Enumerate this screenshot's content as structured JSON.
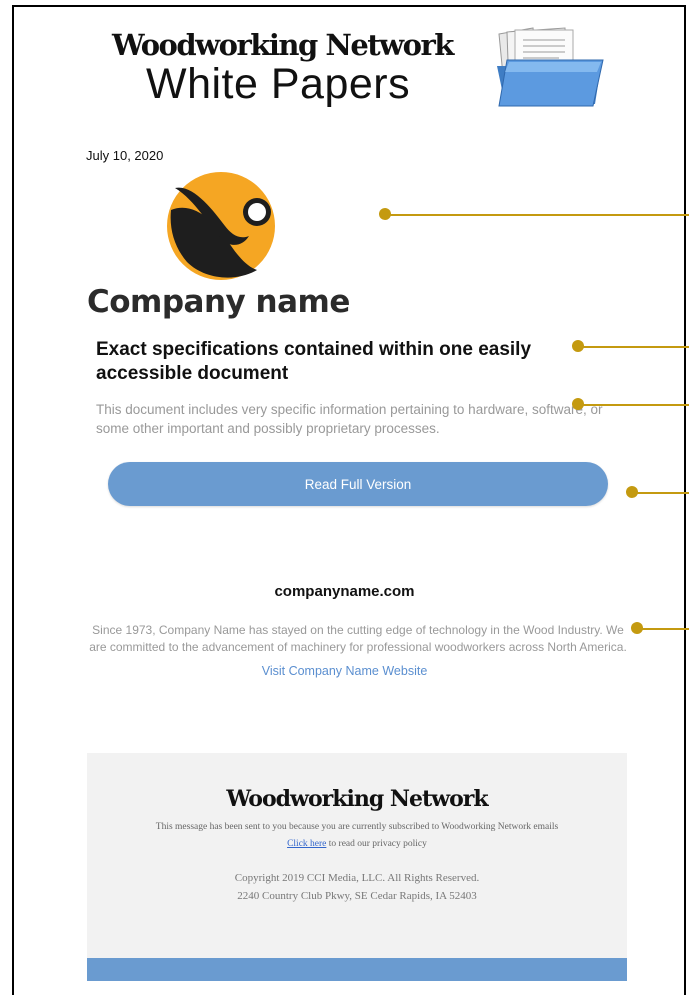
{
  "header": {
    "brand": "Woodworking Network",
    "subtitle": "White Papers"
  },
  "email": {
    "date": "July 10, 2020",
    "company_logo_text": "Company name",
    "headline": "Exact specifications contained within one easily accessible document",
    "description": "This document includes very specific information pertaining to hardware, software, or some other important and possibly proprietary processes.",
    "cta_label": "Read Full Version",
    "site_heading": "companyname.com",
    "about": "Since 1973, Company Name has stayed on the cutting edge of technology in the Wood Industry. We are committed to the advancement of machinery for professional woodworkers across North America.",
    "visit_link": "Visit Company Name Website"
  },
  "footer": {
    "brand": "Woodworking Network",
    "notice": "This message has been sent to you because you are currently subscribed to Woodworking Network emails",
    "privacy_link": "Click here",
    "privacy_text": " to read our privacy policy",
    "copyright": "Copyright 2019 CCI Media, LLC. All Rights Reserved.",
    "address": "2240 Country Club Pkwy, SE Cedar Rapids, IA 52403"
  },
  "colors": {
    "accent": "#6a9bd0",
    "callout": "#c49a10",
    "logo_orange": "#f5a623",
    "logo_dark": "#1e1e1e"
  },
  "icons": [
    "folder-documents-icon",
    "company-logo-icon"
  ]
}
